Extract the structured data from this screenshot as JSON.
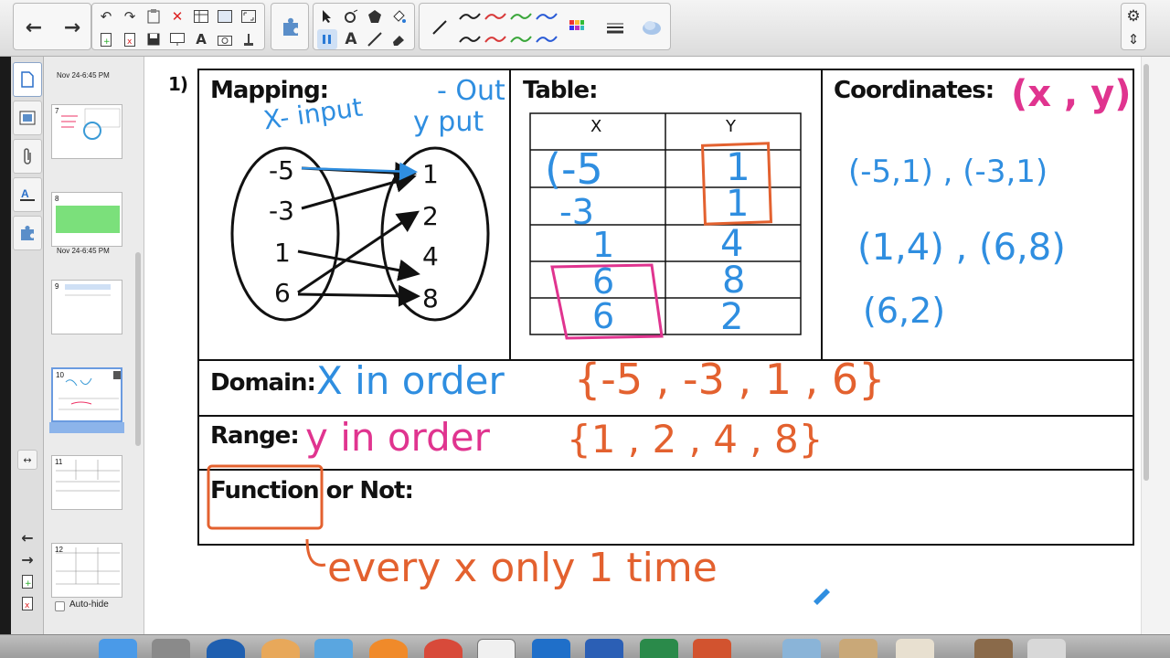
{
  "toolbar": {
    "back_icon": "←",
    "forward_icon": "→",
    "undo_icon": "↶",
    "redo_icon": "↷",
    "delete_icon": "✕",
    "text_icon": "A",
    "settings_icon": "⚙",
    "move_toolbar_icon": "⇕"
  },
  "sidebar": {
    "tabs": [
      "page-sorter",
      "gallery",
      "attachments",
      "properties",
      "add-ons"
    ],
    "thumbnails": [
      {
        "num": "",
        "date": "Nov 24-6:45 PM"
      },
      {
        "num": "7",
        "date": ""
      },
      {
        "num": "8",
        "date": "Nov 24-6:45 PM"
      },
      {
        "num": "9",
        "date": ""
      },
      {
        "num": "10",
        "date": ""
      },
      {
        "num": "11",
        "date": ""
      },
      {
        "num": "12",
        "date": ""
      }
    ],
    "autohide_label": "Auto-hide"
  },
  "page": {
    "problem_number": "1)",
    "mapping_label": "Mapping:",
    "table_label": "Table:",
    "coordinates_label": "Coordinates:",
    "domain_label": "Domain:",
    "range_label": "Range:",
    "function_label": "Function or Not:",
    "mapping_inputs": [
      "-5",
      "-3",
      "1",
      "6"
    ],
    "mapping_outputs": [
      "1",
      "2",
      "4",
      "8"
    ],
    "table_headers": [
      "X",
      "Y"
    ]
  },
  "annotations": {
    "mapping_note_left": "X- input",
    "mapping_note_right1": "- Out",
    "mapping_note_right2": "y  put",
    "coord_pink": "(x , y)",
    "coord_row1": "(-5,1) , (-3,1)",
    "coord_row2": "(1,4) , (6,8)",
    "coord_row3": "(6,2)",
    "table_x": [
      "(-5",
      "-3",
      "1",
      "6",
      "6"
    ],
    "table_y": [
      "1",
      "1",
      "4",
      "8",
      "2"
    ],
    "domain_note": "X in order",
    "domain_set": "{-5 , -3 , 1 , 6}",
    "range_note": "y in order",
    "range_set": "{1 , 2 , 4 , 8}",
    "function_note": "every x only 1 time"
  },
  "colors": {
    "blue_ink": "#2f8ee0",
    "pink_ink": "#e0348f",
    "orange_ink": "#e3612f"
  }
}
